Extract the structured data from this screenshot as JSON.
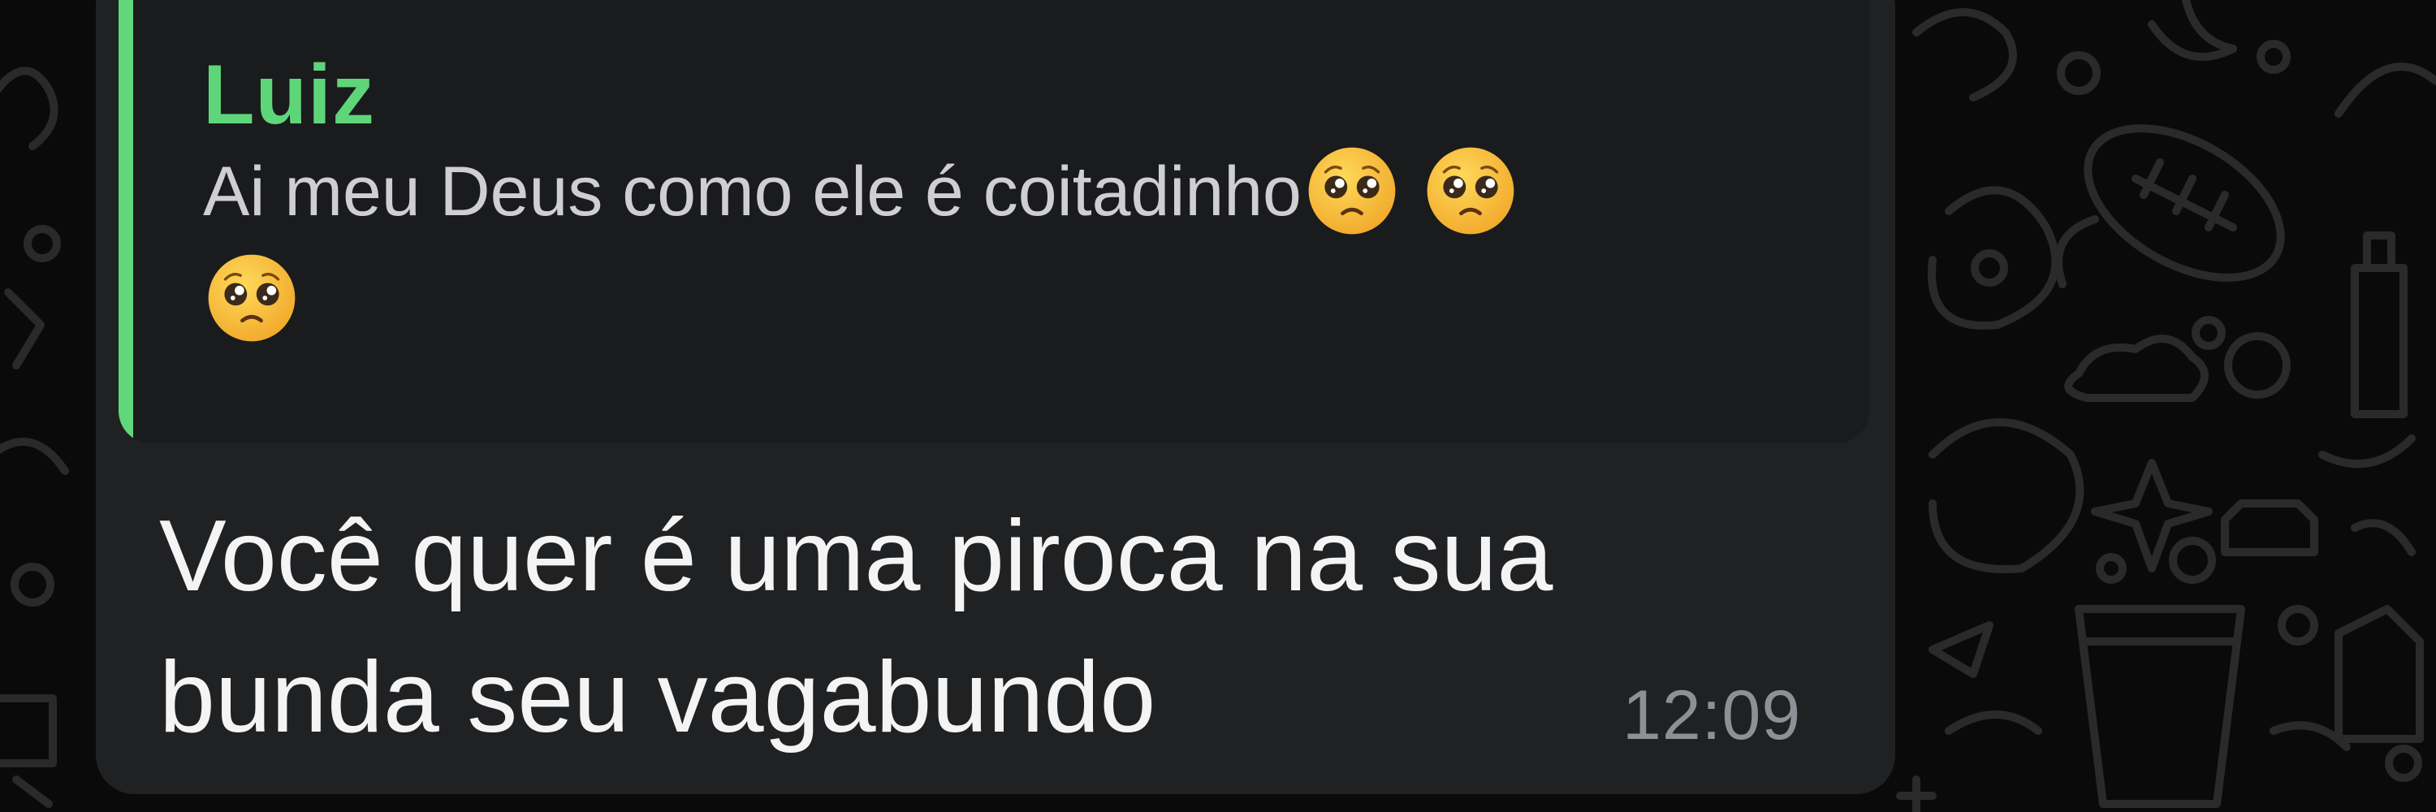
{
  "message": {
    "quote": {
      "author": "Luiz",
      "text": "Ai meu Deus como ele é coitadinho",
      "emojis": [
        "pleading-face",
        "pleading-face",
        "pleading-face"
      ]
    },
    "text": "Você quer é uma piroca na sua bunda seu vagabundo",
    "time": "12:09"
  },
  "colors": {
    "background": "#0a0a0a",
    "bubble": "#202123",
    "quote_background": "#1a1b1c",
    "quote_accent": "#61d67a",
    "message_text": "#f4f4f5",
    "timestamp": "#8f9096"
  }
}
